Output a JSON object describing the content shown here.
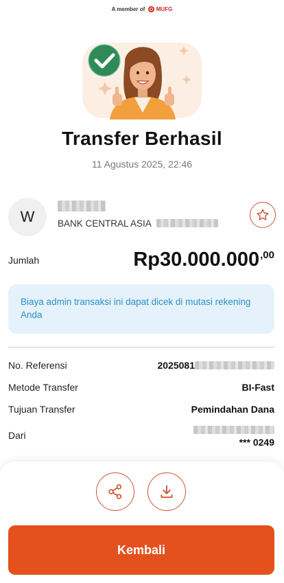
{
  "header": {
    "member_prefix": "A member of",
    "brand": "MUFG"
  },
  "status": {
    "title": "Transfer Berhasil",
    "datetime": "11 Agustus 2025, 22:46"
  },
  "recipient": {
    "avatar_initial": "W",
    "bank_name": "BANK CENTRAL ASIA"
  },
  "amount": {
    "label": "Jumlah",
    "main": "Rp30.000.000",
    "decimals": ",00"
  },
  "notice": {
    "text": "Biaya admin transaksi ini dapat dicek di mutasi rekening Anda"
  },
  "details": {
    "reference_label": "No. Referensi",
    "reference_visible": "2025081",
    "method_label": "Metode Transfer",
    "method_value": "BI-Fast",
    "purpose_label": "Tujuan Transfer",
    "purpose_value": "Pemindahan Dana",
    "from_label": "Dari",
    "from_value": "*** 0249"
  },
  "actions": {
    "share_icon": "share-icon",
    "download_icon": "download-icon",
    "primary_label": "Kembali"
  },
  "colors": {
    "accent": "#e4511c",
    "success": "#2e8b57",
    "notice_bg": "#e6f2fb",
    "notice_text": "#2a8fc7"
  }
}
